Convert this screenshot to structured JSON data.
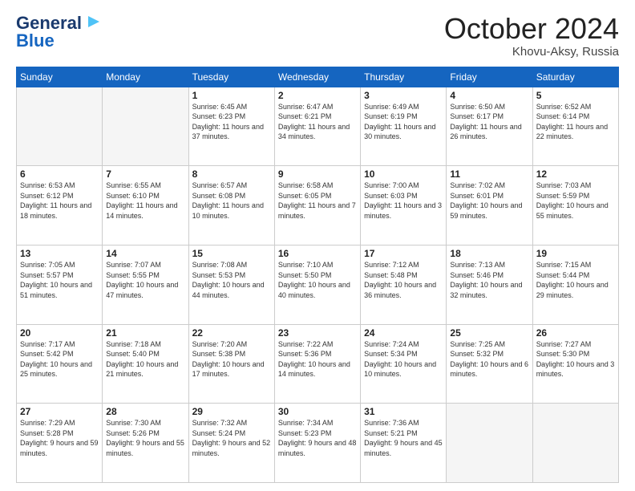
{
  "logo": {
    "line1": "General",
    "line2": "Blue"
  },
  "header": {
    "month": "October 2024",
    "location": "Khovu-Aksy, Russia"
  },
  "weekdays": [
    "Sunday",
    "Monday",
    "Tuesday",
    "Wednesday",
    "Thursday",
    "Friday",
    "Saturday"
  ],
  "weeks": [
    [
      {
        "day": "",
        "sunrise": "",
        "sunset": "",
        "daylight": ""
      },
      {
        "day": "",
        "sunrise": "",
        "sunset": "",
        "daylight": ""
      },
      {
        "day": "1",
        "sunrise": "Sunrise: 6:45 AM",
        "sunset": "Sunset: 6:23 PM",
        "daylight": "Daylight: 11 hours and 37 minutes."
      },
      {
        "day": "2",
        "sunrise": "Sunrise: 6:47 AM",
        "sunset": "Sunset: 6:21 PM",
        "daylight": "Daylight: 11 hours and 34 minutes."
      },
      {
        "day": "3",
        "sunrise": "Sunrise: 6:49 AM",
        "sunset": "Sunset: 6:19 PM",
        "daylight": "Daylight: 11 hours and 30 minutes."
      },
      {
        "day": "4",
        "sunrise": "Sunrise: 6:50 AM",
        "sunset": "Sunset: 6:17 PM",
        "daylight": "Daylight: 11 hours and 26 minutes."
      },
      {
        "day": "5",
        "sunrise": "Sunrise: 6:52 AM",
        "sunset": "Sunset: 6:14 PM",
        "daylight": "Daylight: 11 hours and 22 minutes."
      }
    ],
    [
      {
        "day": "6",
        "sunrise": "Sunrise: 6:53 AM",
        "sunset": "Sunset: 6:12 PM",
        "daylight": "Daylight: 11 hours and 18 minutes."
      },
      {
        "day": "7",
        "sunrise": "Sunrise: 6:55 AM",
        "sunset": "Sunset: 6:10 PM",
        "daylight": "Daylight: 11 hours and 14 minutes."
      },
      {
        "day": "8",
        "sunrise": "Sunrise: 6:57 AM",
        "sunset": "Sunset: 6:08 PM",
        "daylight": "Daylight: 11 hours and 10 minutes."
      },
      {
        "day": "9",
        "sunrise": "Sunrise: 6:58 AM",
        "sunset": "Sunset: 6:05 PM",
        "daylight": "Daylight: 11 hours and 7 minutes."
      },
      {
        "day": "10",
        "sunrise": "Sunrise: 7:00 AM",
        "sunset": "Sunset: 6:03 PM",
        "daylight": "Daylight: 11 hours and 3 minutes."
      },
      {
        "day": "11",
        "sunrise": "Sunrise: 7:02 AM",
        "sunset": "Sunset: 6:01 PM",
        "daylight": "Daylight: 10 hours and 59 minutes."
      },
      {
        "day": "12",
        "sunrise": "Sunrise: 7:03 AM",
        "sunset": "Sunset: 5:59 PM",
        "daylight": "Daylight: 10 hours and 55 minutes."
      }
    ],
    [
      {
        "day": "13",
        "sunrise": "Sunrise: 7:05 AM",
        "sunset": "Sunset: 5:57 PM",
        "daylight": "Daylight: 10 hours and 51 minutes."
      },
      {
        "day": "14",
        "sunrise": "Sunrise: 7:07 AM",
        "sunset": "Sunset: 5:55 PM",
        "daylight": "Daylight: 10 hours and 47 minutes."
      },
      {
        "day": "15",
        "sunrise": "Sunrise: 7:08 AM",
        "sunset": "Sunset: 5:53 PM",
        "daylight": "Daylight: 10 hours and 44 minutes."
      },
      {
        "day": "16",
        "sunrise": "Sunrise: 7:10 AM",
        "sunset": "Sunset: 5:50 PM",
        "daylight": "Daylight: 10 hours and 40 minutes."
      },
      {
        "day": "17",
        "sunrise": "Sunrise: 7:12 AM",
        "sunset": "Sunset: 5:48 PM",
        "daylight": "Daylight: 10 hours and 36 minutes."
      },
      {
        "day": "18",
        "sunrise": "Sunrise: 7:13 AM",
        "sunset": "Sunset: 5:46 PM",
        "daylight": "Daylight: 10 hours and 32 minutes."
      },
      {
        "day": "19",
        "sunrise": "Sunrise: 7:15 AM",
        "sunset": "Sunset: 5:44 PM",
        "daylight": "Daylight: 10 hours and 29 minutes."
      }
    ],
    [
      {
        "day": "20",
        "sunrise": "Sunrise: 7:17 AM",
        "sunset": "Sunset: 5:42 PM",
        "daylight": "Daylight: 10 hours and 25 minutes."
      },
      {
        "day": "21",
        "sunrise": "Sunrise: 7:18 AM",
        "sunset": "Sunset: 5:40 PM",
        "daylight": "Daylight: 10 hours and 21 minutes."
      },
      {
        "day": "22",
        "sunrise": "Sunrise: 7:20 AM",
        "sunset": "Sunset: 5:38 PM",
        "daylight": "Daylight: 10 hours and 17 minutes."
      },
      {
        "day": "23",
        "sunrise": "Sunrise: 7:22 AM",
        "sunset": "Sunset: 5:36 PM",
        "daylight": "Daylight: 10 hours and 14 minutes."
      },
      {
        "day": "24",
        "sunrise": "Sunrise: 7:24 AM",
        "sunset": "Sunset: 5:34 PM",
        "daylight": "Daylight: 10 hours and 10 minutes."
      },
      {
        "day": "25",
        "sunrise": "Sunrise: 7:25 AM",
        "sunset": "Sunset: 5:32 PM",
        "daylight": "Daylight: 10 hours and 6 minutes."
      },
      {
        "day": "26",
        "sunrise": "Sunrise: 7:27 AM",
        "sunset": "Sunset: 5:30 PM",
        "daylight": "Daylight: 10 hours and 3 minutes."
      }
    ],
    [
      {
        "day": "27",
        "sunrise": "Sunrise: 7:29 AM",
        "sunset": "Sunset: 5:28 PM",
        "daylight": "Daylight: 9 hours and 59 minutes."
      },
      {
        "day": "28",
        "sunrise": "Sunrise: 7:30 AM",
        "sunset": "Sunset: 5:26 PM",
        "daylight": "Daylight: 9 hours and 55 minutes."
      },
      {
        "day": "29",
        "sunrise": "Sunrise: 7:32 AM",
        "sunset": "Sunset: 5:24 PM",
        "daylight": "Daylight: 9 hours and 52 minutes."
      },
      {
        "day": "30",
        "sunrise": "Sunrise: 7:34 AM",
        "sunset": "Sunset: 5:23 PM",
        "daylight": "Daylight: 9 hours and 48 minutes."
      },
      {
        "day": "31",
        "sunrise": "Sunrise: 7:36 AM",
        "sunset": "Sunset: 5:21 PM",
        "daylight": "Daylight: 9 hours and 45 minutes."
      },
      {
        "day": "",
        "sunrise": "",
        "sunset": "",
        "daylight": ""
      },
      {
        "day": "",
        "sunrise": "",
        "sunset": "",
        "daylight": ""
      }
    ]
  ]
}
